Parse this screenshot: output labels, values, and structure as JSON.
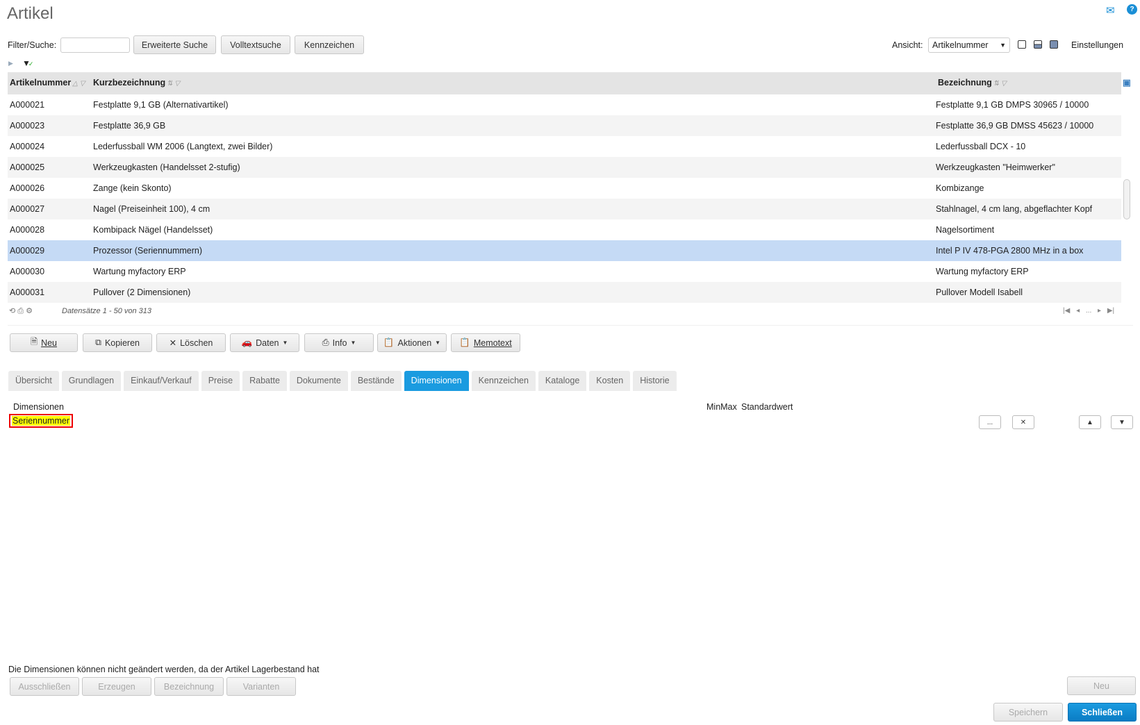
{
  "page_title": "Artikel",
  "filter": {
    "label": "Filter/Suche:",
    "value": "",
    "buttons": [
      "Erweiterte Suche",
      "Volltextsuche",
      "Kennzeichen"
    ]
  },
  "view": {
    "label": "Ansicht:",
    "selected": "Artikelnummer",
    "settings": "Einstellungen"
  },
  "grid": {
    "columns": [
      "Artikelnummer",
      "Kurzbezeichnung",
      "Bezeichnung"
    ],
    "rows": [
      [
        "A000021",
        "Festplatte 9,1 GB (Alternativartikel)",
        "Festplatte 9,1 GB DMPS 30965 / 10000"
      ],
      [
        "A000023",
        "Festplatte 36,9 GB",
        "Festplatte 36,9 GB DMSS 45623 / 10000"
      ],
      [
        "A000024",
        "Lederfussball WM 2006 (Langtext, zwei Bilder)",
        "Lederfussball DCX - 10"
      ],
      [
        "A000025",
        "Werkzeugkasten (Handelsset 2-stufig)",
        "Werkzeugkasten \"Heimwerker\""
      ],
      [
        "A000026",
        "Zange (kein Skonto)",
        "Kombizange"
      ],
      [
        "A000027",
        "Nagel (Preiseinheit 100), 4 cm",
        "Stahlnagel, 4 cm lang, abgeflachter Kopf"
      ],
      [
        "A000028",
        "Kombipack Nägel (Handelsset)",
        "Nagelsortiment"
      ],
      [
        "A000029",
        "Prozessor (Seriennummern)",
        "Intel P IV 478-PGA 2800 MHz in a box"
      ],
      [
        "A000030",
        "Wartung myfactory ERP",
        "Wartung myfactory ERP"
      ],
      [
        "A000031",
        "Pullover (2 Dimensionen)",
        "Pullover Modell Isabell"
      ]
    ],
    "selected_index": 7,
    "records": "Datensätze 1 - 50 von 313",
    "pager_ellipsis": "..."
  },
  "actions": [
    "Neu",
    "Kopieren",
    "Löschen",
    "Daten",
    "Info",
    "Aktionen",
    "Memotext"
  ],
  "tabs": [
    "Übersicht",
    "Grundlagen",
    "Einkauf/Verkauf",
    "Preise",
    "Rabatte",
    "Dokumente",
    "Bestände",
    "Dimensionen",
    "Kennzeichen",
    "Kataloge",
    "Kosten",
    "Historie"
  ],
  "active_tab": "Dimensionen",
  "dimensions": {
    "label": "Dimensionen",
    "minmax": "MinMax",
    "default": "Standardwert",
    "item": "Seriennummer",
    "more": "..."
  },
  "message": "Die Dimensionen können nicht geändert werden, da der Artikel Lagerbestand hat",
  "bottom_buttons": [
    "Ausschließen",
    "Erzeugen",
    "Bezeichnung",
    "Varianten"
  ],
  "neu": "Neu",
  "save": "Speichern",
  "close": "Schließen"
}
